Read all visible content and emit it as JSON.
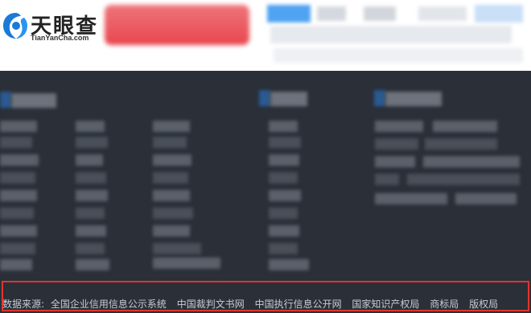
{
  "header": {
    "logo_cn": "天眼查",
    "logo_en": "TianYanCha.com"
  },
  "footer": {
    "source_label": "数据来源:",
    "sources": [
      "全国企业信用信息公示系统",
      "中国裁判文书网",
      "中国执行信息公开网",
      "国家知识产权局",
      "商标局",
      "版权局"
    ]
  },
  "colors": {
    "header_bg": "#ffffff",
    "footer_bg": "#2a2f38",
    "highlight_border": "#e0352e",
    "logo_blue": "#1a7ad8",
    "blurred_red": "#e8474e"
  }
}
